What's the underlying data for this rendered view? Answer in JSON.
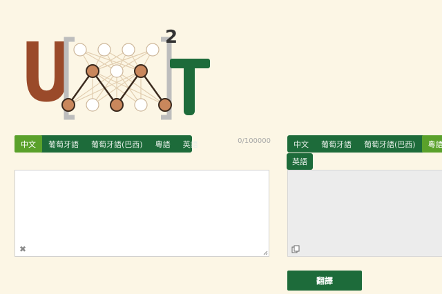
{
  "logo": {
    "left_letter": "U",
    "right_letter": "T",
    "superscript": "2"
  },
  "source": {
    "tabs": [
      "中文",
      "葡萄牙語",
      "葡萄牙語(巴西)",
      "粵語",
      "英語"
    ],
    "active_tab": "中文",
    "counter": "0/100000",
    "text": ""
  },
  "target": {
    "tabs": [
      "中文",
      "葡萄牙語",
      "葡萄牙語(巴西)",
      "粵語"
    ],
    "tabs_row2": [
      "英語"
    ],
    "active_tab": "粵語",
    "text": ""
  },
  "translate_button": "翻譯",
  "colors": {
    "background": "#fcf6e5",
    "tab_bar": "#1d6b3a",
    "tab_active": "#5aa12b",
    "logo_brown": "#9a4a2a",
    "logo_green": "#1d6b3a"
  },
  "icons": {
    "clear": "close-icon",
    "copy": "copy-icon"
  }
}
